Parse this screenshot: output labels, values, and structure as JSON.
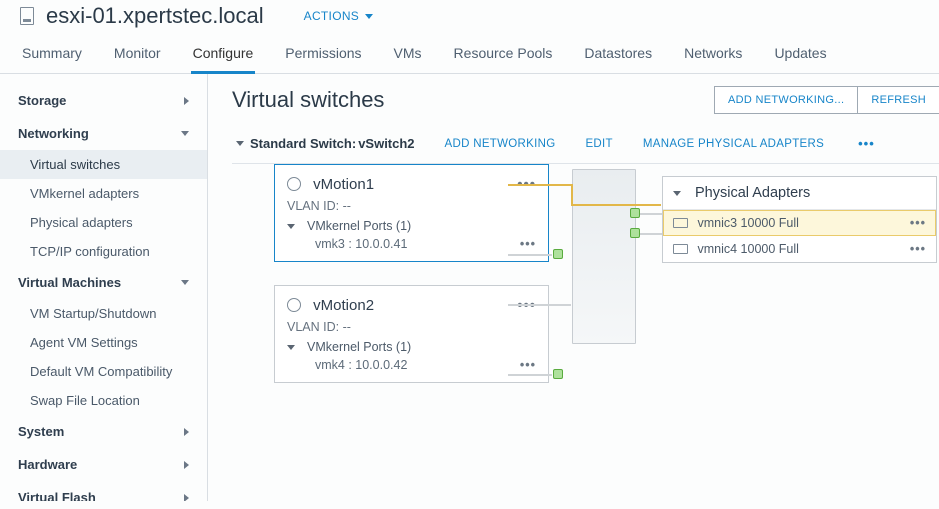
{
  "header": {
    "host_title": "esxi-01.xpertstec.local",
    "actions_label": "ACTIONS"
  },
  "tabs": [
    {
      "label": "Summary"
    },
    {
      "label": "Monitor"
    },
    {
      "label": "Configure",
      "active": true
    },
    {
      "label": "Permissions"
    },
    {
      "label": "VMs"
    },
    {
      "label": "Resource Pools"
    },
    {
      "label": "Datastores"
    },
    {
      "label": "Networks"
    },
    {
      "label": "Updates"
    }
  ],
  "sidebar": {
    "storage": "Storage",
    "networking": "Networking",
    "networking_items": [
      "Virtual switches",
      "VMkernel adapters",
      "Physical adapters",
      "TCP/IP configuration"
    ],
    "vm": "Virtual Machines",
    "vm_items": [
      "VM Startup/Shutdown",
      "Agent VM Settings",
      "Default VM Compatibility",
      "Swap File Location"
    ],
    "system": "System",
    "hardware": "Hardware",
    "virtual_flash": "Virtual Flash"
  },
  "content": {
    "title": "Virtual switches",
    "add_networking_btn": "ADD NETWORKING...",
    "refresh_btn": "REFRESH",
    "switch_label_prefix": "Standard Switch: ",
    "switch_name": "vSwitch2",
    "actions": {
      "add": "ADD NETWORKING",
      "edit": "EDIT",
      "manage": "MANAGE PHYSICAL ADAPTERS"
    }
  },
  "portgroups": [
    {
      "name": "vMotion1",
      "vlan_label": "VLAN ID: --",
      "ports_label": "VMkernel Ports (1)",
      "vmk": "vmk3 : 10.0.0.41"
    },
    {
      "name": "vMotion2",
      "vlan_label": "VLAN ID: --",
      "ports_label": "VMkernel Ports (1)",
      "vmk": "vmk4 : 10.0.0.42"
    }
  ],
  "physical": {
    "title": "Physical Adapters",
    "nics": [
      "vmnic3 10000 Full",
      "vmnic4 10000 Full"
    ]
  }
}
